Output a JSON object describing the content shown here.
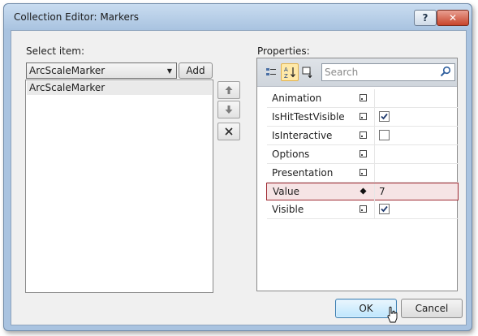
{
  "window": {
    "title": "Collection Editor: Markers",
    "help_label": "?",
    "close_label": "✕"
  },
  "left": {
    "select_label": "Select item:",
    "combo_value": "ArcScaleMarker",
    "add_label": "Add",
    "list_items": [
      "ArcScaleMarker"
    ]
  },
  "side_buttons": {
    "up_icon": "arrow-up-icon",
    "down_icon": "arrow-down-icon",
    "remove_icon": "close-icon"
  },
  "properties": {
    "label": "Properties:",
    "search_placeholder": "Search",
    "rows": [
      {
        "name": "Animation",
        "value": "",
        "checkbox": null,
        "selected": false
      },
      {
        "name": "IsHitTestVisible",
        "value": "",
        "checkbox": true,
        "selected": false
      },
      {
        "name": "IsInteractive",
        "value": "",
        "checkbox": false,
        "selected": false
      },
      {
        "name": "Options",
        "value": "",
        "checkbox": null,
        "selected": false
      },
      {
        "name": "Presentation",
        "value": "",
        "checkbox": null,
        "selected": false
      },
      {
        "name": "Value",
        "value": "7",
        "checkbox": null,
        "selected": true
      },
      {
        "name": "Visible",
        "value": "",
        "checkbox": true,
        "selected": false
      }
    ]
  },
  "footer": {
    "ok_label": "OK",
    "cancel_label": "Cancel"
  }
}
